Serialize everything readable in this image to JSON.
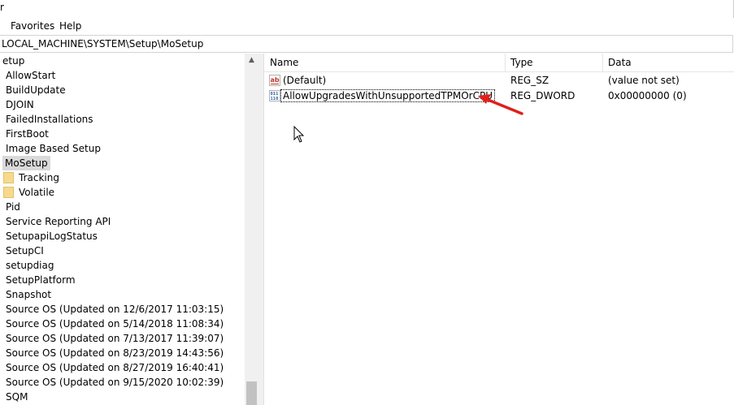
{
  "window": {
    "title_fragment": "r"
  },
  "menu": {
    "favorites": "Favorites",
    "help": "Help"
  },
  "address": {
    "path": "LOCAL_MACHINE\\SYSTEM\\Setup\\MoSetup"
  },
  "tree": {
    "items": [
      {
        "label": "etup",
        "type": "key",
        "selected": false
      },
      {
        "label": "AllowStart",
        "type": "key",
        "selected": false
      },
      {
        "label": "BuildUpdate",
        "type": "key",
        "selected": false
      },
      {
        "label": "DJOIN",
        "type": "key",
        "selected": false
      },
      {
        "label": "FailedInstallations",
        "type": "key",
        "selected": false
      },
      {
        "label": "FirstBoot",
        "type": "key",
        "selected": false
      },
      {
        "label": "Image Based Setup",
        "type": "key",
        "selected": false
      },
      {
        "label": "MoSetup",
        "type": "key",
        "selected": true
      },
      {
        "label": "Tracking",
        "type": "folder",
        "selected": false
      },
      {
        "label": "Volatile",
        "type": "folder",
        "selected": false
      },
      {
        "label": "Pid",
        "type": "key",
        "selected": false
      },
      {
        "label": "Service Reporting API",
        "type": "key",
        "selected": false
      },
      {
        "label": "SetupapiLogStatus",
        "type": "key",
        "selected": false
      },
      {
        "label": "SetupCI",
        "type": "key",
        "selected": false
      },
      {
        "label": "setupdiag",
        "type": "key",
        "selected": false
      },
      {
        "label": "SetupPlatform",
        "type": "key",
        "selected": false
      },
      {
        "label": "Snapshot",
        "type": "key",
        "selected": false
      },
      {
        "label": "Source OS (Updated on 12/6/2017 11:03:15)",
        "type": "key",
        "selected": false
      },
      {
        "label": "Source OS (Updated on 5/14/2018 11:08:34)",
        "type": "key",
        "selected": false
      },
      {
        "label": "Source OS (Updated on 7/13/2017 11:39:07)",
        "type": "key",
        "selected": false
      },
      {
        "label": "Source OS (Updated on 8/23/2019 14:43:56)",
        "type": "key",
        "selected": false
      },
      {
        "label": "Source OS (Updated on 8/27/2019 16:40:41)",
        "type": "key",
        "selected": false
      },
      {
        "label": "Source OS (Updated on 9/15/2020 10:02:39)",
        "type": "key",
        "selected": false
      },
      {
        "label": "SQM",
        "type": "key",
        "selected": false
      }
    ]
  },
  "columns": {
    "name": "Name",
    "type": "Type",
    "data": "Data"
  },
  "values": [
    {
      "name": "(Default)",
      "type": "REG_SZ",
      "data": "(value not set)",
      "icon": "string-value-icon",
      "icon_text": "ab"
    },
    {
      "name": "AllowUpgradesWithUnsupportedTPMOrCPU",
      "type": "REG_DWORD",
      "data": "0x00000000 (0)",
      "icon": "dword-value-icon",
      "icon_text": "011\n110"
    }
  ],
  "colors": {
    "selected_bg": "#d9d9d9",
    "folder": "#f6d98d",
    "annotation_arrow": "#e0201a",
    "string_icon": "#c0392b",
    "dword_icon": "#2f5fa7"
  }
}
